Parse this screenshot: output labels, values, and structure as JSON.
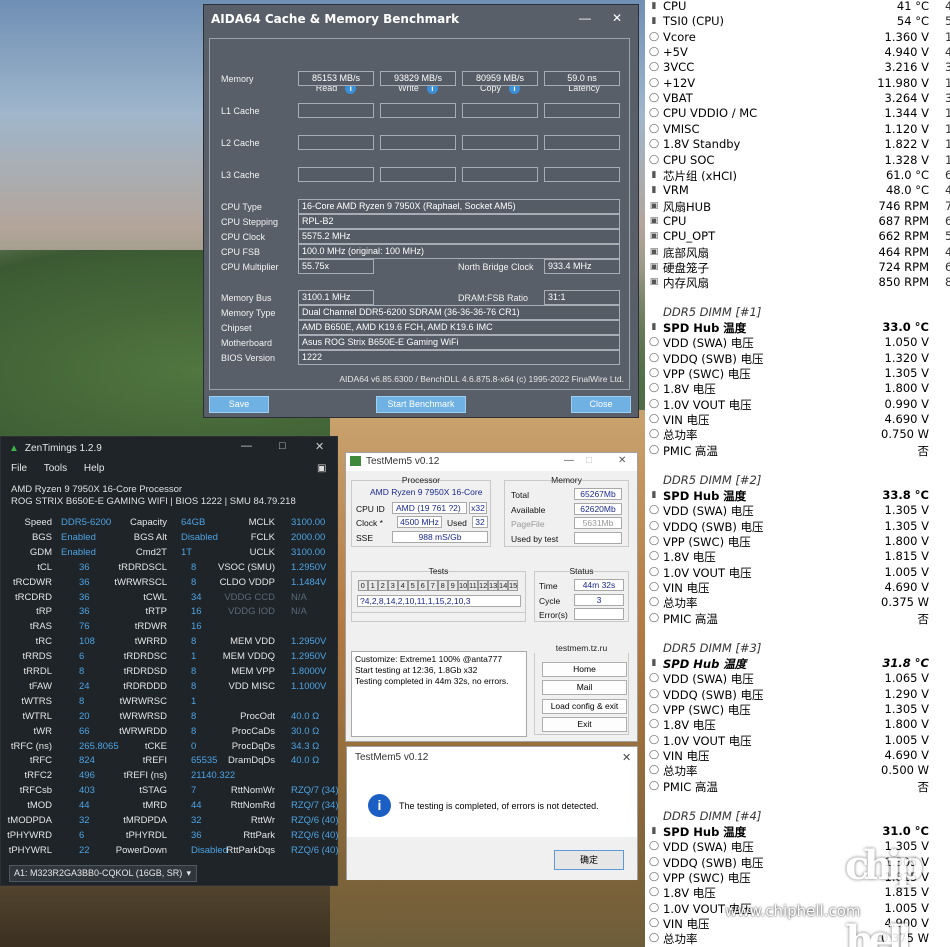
{
  "aida": {
    "title": "AIDA64 Cache & Memory Benchmark",
    "col_read": "Read",
    "col_write": "Write",
    "col_copy": "Copy",
    "col_latency": "Latency",
    "row_memory": "Memory",
    "row_l1": "L1 Cache",
    "row_l2": "L2 Cache",
    "row_l3": "L3 Cache",
    "mem_read": "85153 MB/s",
    "mem_write": "93829 MB/s",
    "mem_copy": "80959 MB/s",
    "mem_latency": "59.0 ns",
    "cpu_type_label": "CPU Type",
    "cpu_type": "16-Core AMD Ryzen 9 7950X  (Raphael, Socket AM5)",
    "cpu_stepping_label": "CPU Stepping",
    "cpu_stepping": "RPL-B2",
    "cpu_clock_label": "CPU Clock",
    "cpu_clock": "5575.2 MHz",
    "cpu_fsb_label": "CPU FSB",
    "cpu_fsb": "100.0 MHz  (original: 100 MHz)",
    "cpu_mult_label": "CPU Multiplier",
    "cpu_mult": "55.75x",
    "nb_clock_label": "North Bridge Clock",
    "nb_clock": "933.4 MHz",
    "mem_bus_label": "Memory Bus",
    "mem_bus": "3100.1 MHz",
    "dram_ratio_label": "DRAM:FSB Ratio",
    "dram_ratio": "31:1",
    "mem_type_label": "Memory Type",
    "mem_type": "Dual Channel DDR5-6200 SDRAM  (36-36-36-76 CR1)",
    "chipset_label": "Chipset",
    "chipset": "AMD B650E, AMD K19.6 FCH, AMD K19.6 IMC",
    "mobo_label": "Motherboard",
    "mobo": "Asus ROG Strix B650E-E Gaming WiFi",
    "bios_label": "BIOS Version",
    "bios": "1222",
    "footer": "AIDA64 v6.85.6300 / BenchDLL 4.6.875.8-x64  (c) 1995-2022 FinalWire Ltd.",
    "btn_save": "Save",
    "btn_start": "Start Benchmark",
    "btn_close": "Close"
  },
  "zen": {
    "title": "ZenTimings 1.2.9",
    "menu": [
      "File",
      "Tools",
      "Help"
    ],
    "cpu": "AMD Ryzen 9 7950X 16-Core Processor",
    "board": "ROG STRIX B650E-E GAMING WIFI | BIOS 1222 | SMU 84.79.218",
    "rows": [
      [
        "Speed",
        "DDR5-6200",
        "Capacity",
        "64GB",
        "MCLK",
        "3100.00"
      ],
      [
        "BGS",
        "Enabled",
        "BGS Alt",
        "Disabled",
        "FCLK",
        "2000.00"
      ],
      [
        "GDM",
        "Enabled",
        "Cmd2T",
        "1T",
        "UCLK",
        "3100.00"
      ],
      [
        "tCL",
        "36",
        "tRDRDSCL",
        "8",
        "VSOC (SMU)",
        "1.2950V"
      ],
      [
        "tRCDWR",
        "36",
        "tWRWRSCL",
        "8",
        "CLDO VDDP",
        "1.1484V"
      ],
      [
        "tRCDRD",
        "36",
        "tCWL",
        "34",
        "VDDG CCD",
        "N/A"
      ],
      [
        "tRP",
        "36",
        "tRTP",
        "16",
        "VDDG IOD",
        "N/A"
      ],
      [
        "tRAS",
        "76",
        "tRDWR",
        "16",
        "",
        ""
      ],
      [
        "tRC",
        "108",
        "tWRRD",
        "8",
        "MEM VDD",
        "1.2950V"
      ],
      [
        "tRRDS",
        "6",
        "tRDRDSC",
        "1",
        "MEM VDDQ",
        "1.2950V"
      ],
      [
        "tRRDL",
        "8",
        "tRDRDSD",
        "8",
        "MEM VPP",
        "1.8000V"
      ],
      [
        "tFAW",
        "24",
        "tRDRDDD",
        "8",
        "VDD MISC",
        "1.1000V"
      ],
      [
        "tWTRS",
        "8",
        "tWRWRSC",
        "1",
        "",
        ""
      ],
      [
        "tWTRL",
        "20",
        "tWRWRSD",
        "8",
        "ProcOdt",
        "40.0 Ω"
      ],
      [
        "tWR",
        "66",
        "tWRWRDD",
        "8",
        "ProcCaDs",
        "30.0 Ω"
      ],
      [
        "tRFC (ns)",
        "265.8065",
        "tCKE",
        "0",
        "ProcDqDs",
        "34.3 Ω"
      ],
      [
        "tRFC",
        "824",
        "tREFI",
        "65535",
        "DramDqDs",
        "40.0 Ω"
      ],
      [
        "tRFC2",
        "496",
        "tREFI (ns)",
        "21140.322",
        "",
        ""
      ],
      [
        "tRFCsb",
        "403",
        "tSTAG",
        "7",
        "RttNomWr",
        "RZQ/7 (34)"
      ],
      [
        "tMOD",
        "44",
        "tMRD",
        "44",
        "RttNomRd",
        "RZQ/7 (34)"
      ],
      [
        "tMODPDA",
        "32",
        "tMRDPDA",
        "32",
        "RttWr",
        "RZQ/6 (40)"
      ],
      [
        "tPHYWRD",
        "6",
        "tPHYRDL",
        "36",
        "RttPark",
        "RZQ/6 (40)"
      ],
      [
        "tPHYWRL",
        "22",
        "PowerDown",
        "Disabled",
        "RttParkDqs",
        "RZQ/6 (40)"
      ]
    ],
    "module": "A1: M323R2GA3BB0-CQKOL (16GB, SR)"
  },
  "testmem": {
    "title": "TestMem5 v0.12",
    "processor_label": "Processor",
    "processor": "AMD Ryzen 9 7950X 16-Core",
    "cpu_id_label": "CPU ID",
    "cpu_id": "AMD  (19 761 ?2)",
    "cpu_id_x": "x32",
    "clock_label": "Clock *",
    "clock": "4500 MHz",
    "used_label": "Used",
    "used": "32",
    "sse_label": "SSE",
    "sse": "988 mS/Gb",
    "memory_label": "Memory",
    "total_label": "Total",
    "total": "65267Mb",
    "available_label": "Available",
    "available": "62620Mb",
    "pagefile_label": "PageFile",
    "pagefile": "5631Mb",
    "usedbytest_label": "Used by test",
    "usedbytest": "",
    "tests_label": "Tests",
    "test_cells": [
      "0",
      "1",
      "2",
      "3",
      "4",
      "5",
      "6",
      "7",
      "8",
      "9",
      "10",
      "11",
      "12",
      "13",
      "14",
      "15"
    ],
    "test_seq": "?4,2,8,14,2,10,11,1,15,2,10,3",
    "status_label": "Status",
    "time_label": "Time",
    "time": "44m 32s",
    "cycle_label": "Cycle",
    "cycle": "3",
    "errors_label": "Error(s)",
    "errors": "",
    "log": [
      "Customize: Extreme1 100% @anta777",
      "Start testing at 12:36, 1.8Gb x32",
      "Testing completed in 44m 32s, no errors."
    ],
    "site": "testmem.tz.ru",
    "btn_home": "Home",
    "btn_mail": "Mail",
    "btn_load": "Load config & exit",
    "btn_exit": "Exit"
  },
  "dialog": {
    "title": "TestMem5 v0.12",
    "message": "The testing is completed, of errors is not detected.",
    "ok": "确定"
  },
  "sensors": {
    "top": [
      [
        "CPU",
        "41 °C",
        "4"
      ],
      [
        "TSI0 (CPU)",
        "54 °C",
        "5"
      ],
      [
        "Vcore",
        "1.360 V",
        "1"
      ],
      [
        "+5V",
        "4.940 V",
        "4"
      ],
      [
        "3VCC",
        "3.216 V",
        "3"
      ],
      [
        "+12V",
        "11.980 V",
        "11"
      ],
      [
        "VBAT",
        "3.264 V",
        "3"
      ],
      [
        "CPU VDDIO / MC",
        "1.344 V",
        "1"
      ],
      [
        "VMISC",
        "1.120 V",
        "1"
      ],
      [
        "1.8V Standby",
        "1.822 V",
        "1"
      ],
      [
        "CPU SOC",
        "1.328 V",
        "1"
      ],
      [
        "芯片组 (xHCI)",
        "61.0 °C",
        "6"
      ],
      [
        "VRM",
        "48.0 °C",
        "4"
      ],
      [
        "风扇HUB",
        "746 RPM",
        "7"
      ],
      [
        "CPU",
        "687 RPM",
        "6"
      ],
      [
        "CPU_OPT",
        "662 RPM",
        "5"
      ],
      [
        "底部风扇",
        "464 RPM",
        "4"
      ],
      [
        "硬盘笼子",
        "724 RPM",
        "6"
      ],
      [
        "内存风扇",
        "850 RPM",
        "8"
      ]
    ],
    "dimms": [
      {
        "header": "DDR5 DIMM [#1]",
        "rows": [
          [
            "SPD Hub 温度",
            "33.0 °C"
          ],
          [
            "VDD (SWA) 电压",
            "1.050 V"
          ],
          [
            "VDDQ (SWB) 电压",
            "1.320 V"
          ],
          [
            "VPP (SWC) 电压",
            "1.305 V"
          ],
          [
            "1.8V 电压",
            "1.800 V"
          ],
          [
            "1.0V VOUT 电压",
            "0.990 V"
          ],
          [
            "VIN 电压",
            "4.690 V"
          ],
          [
            "总功率",
            "0.750 W"
          ],
          [
            "PMIC 高温",
            "否"
          ]
        ]
      },
      {
        "header": "DDR5 DIMM [#2]",
        "rows": [
          [
            "SPD Hub 温度",
            "33.8 °C"
          ],
          [
            "VDD (SWA) 电压",
            "1.305 V"
          ],
          [
            "VDDQ (SWB) 电压",
            "1.305 V"
          ],
          [
            "VPP (SWC) 电压",
            "1.800 V"
          ],
          [
            "1.8V 电压",
            "1.815 V"
          ],
          [
            "1.0V VOUT 电压",
            "1.005 V"
          ],
          [
            "VIN 电压",
            "4.690 V"
          ],
          [
            "总功率",
            "0.375 W"
          ],
          [
            "PMIC 高温",
            "否"
          ]
        ]
      },
      {
        "header": "DDR5 DIMM [#3]",
        "rows": [
          [
            "SPD Hub 温度",
            "31.8 °C"
          ],
          [
            "VDD (SWA) 电压",
            "1.065 V"
          ],
          [
            "VDDQ (SWB) 电压",
            "1.290 V"
          ],
          [
            "VPP (SWC) 电压",
            "1.305 V"
          ],
          [
            "1.8V 电压",
            "1.800 V"
          ],
          [
            "1.0V VOUT 电压",
            "1.005 V"
          ],
          [
            "VIN 电压",
            "4.690 V"
          ],
          [
            "总功率",
            "0.500 W"
          ],
          [
            "PMIC 高温",
            "否"
          ]
        ]
      },
      {
        "header": "DDR5 DIMM [#4]",
        "rows": [
          [
            "SPD Hub 温度",
            "31.0 °C"
          ],
          [
            "VDD (SWA) 电压",
            "1.305 V"
          ],
          [
            "VDDQ (SWB) 电压",
            "1.305 V"
          ],
          [
            "VPP (SWC) 电压",
            "1.815 V"
          ],
          [
            "1.8V 电压",
            "1.815 V"
          ],
          [
            "1.0V VOUT 电压",
            "1.005 V"
          ],
          [
            "VIN 电压",
            "4.900 V"
          ],
          [
            "总功率",
            "0.375 W"
          ]
        ]
      }
    ],
    "watermark": "www.chiphell.com",
    "watermark_logo": "chip hell"
  }
}
